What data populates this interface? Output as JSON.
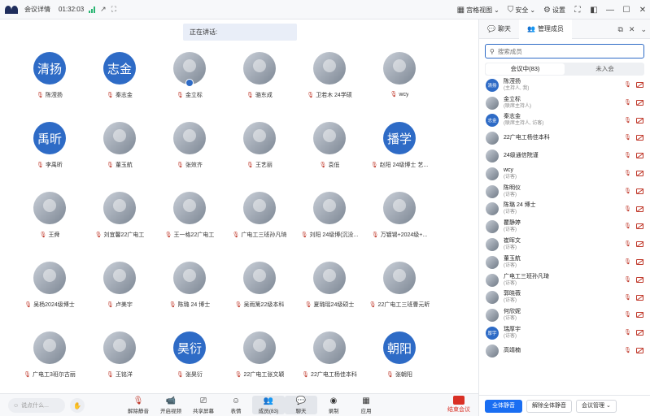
{
  "topbar": {
    "title": "会议详情",
    "time": "01:32:03",
    "right": {
      "gallery": "宫格视图",
      "security": "安全",
      "settings": "设置"
    }
  },
  "main": {
    "speaking_label": "正在讲话:",
    "tiles": [
      {
        "name": "陈滢扬",
        "avatar_text": "清扬",
        "badge": "host"
      },
      {
        "name": "秦志金",
        "avatar_text": "志金",
        "badge": "cohost"
      },
      {
        "name": "金立标",
        "avatar_text": "",
        "badge": "cohost"
      },
      {
        "name": "骆东成",
        "avatar_text": "",
        "badge": ""
      },
      {
        "name": "卫若木 24学硕",
        "avatar_text": "",
        "badge": ""
      },
      {
        "name": "wcy",
        "avatar_text": "",
        "badge": ""
      },
      {
        "name": "李禹昕",
        "avatar_text": "禹昕",
        "badge": ""
      },
      {
        "name": "董玉航",
        "avatar_text": "",
        "badge": ""
      },
      {
        "name": "张效齐",
        "avatar_text": "",
        "badge": ""
      },
      {
        "name": "王艺丽",
        "avatar_text": "",
        "badge": ""
      },
      {
        "name": "袁低",
        "avatar_text": "",
        "badge": ""
      },
      {
        "name": "赵阳 24级博士 艺...",
        "avatar_text": "播学",
        "badge": ""
      },
      {
        "name": "王舜",
        "avatar_text": "",
        "badge": ""
      },
      {
        "name": "刘宜馨22广电工",
        "avatar_text": "",
        "badge": ""
      },
      {
        "name": "王一格22广电工",
        "avatar_text": "",
        "badge": ""
      },
      {
        "name": "广电工三班孙凡琦",
        "avatar_text": "",
        "badge": ""
      },
      {
        "name": "刘阳 24级博(沉没...",
        "avatar_text": "",
        "badge": ""
      },
      {
        "name": "万镀锡+2024级+...",
        "avatar_text": "",
        "badge": ""
      },
      {
        "name": "吴杨2024级博士",
        "avatar_text": "",
        "badge": ""
      },
      {
        "name": "卢美宇",
        "avatar_text": "",
        "badge": ""
      },
      {
        "name": "陈璐 24 博士",
        "avatar_text": "",
        "badge": ""
      },
      {
        "name": "吴雨篱22级本科",
        "avatar_text": "",
        "badge": ""
      },
      {
        "name": "夏璐瑶24级硕士",
        "avatar_text": "",
        "badge": ""
      },
      {
        "name": "22广电工三班曹元昕",
        "avatar_text": "",
        "badge": ""
      },
      {
        "name": "广电工3班尔古丽",
        "avatar_text": "",
        "badge": ""
      },
      {
        "name": "王铭洋",
        "avatar_text": "",
        "badge": ""
      },
      {
        "name": "张昊衍",
        "avatar_text": "昊衍",
        "badge": ""
      },
      {
        "name": "22广电工张文颖",
        "avatar_text": "",
        "badge": ""
      },
      {
        "name": "22广电工杨佳本科",
        "avatar_text": "",
        "badge": ""
      },
      {
        "name": "张朝阳",
        "avatar_text": "朝阳",
        "badge": ""
      }
    ]
  },
  "bottombar": {
    "say_placeholder": "说点什么...",
    "tools": [
      {
        "id": "unmute",
        "label": "解除静音"
      },
      {
        "id": "video",
        "label": "开启视频"
      },
      {
        "id": "share",
        "label": "共享屏幕"
      },
      {
        "id": "react",
        "label": "表情"
      },
      {
        "id": "members",
        "label": "成员(83)"
      },
      {
        "id": "chat",
        "label": "聊天"
      },
      {
        "id": "record",
        "label": "录制"
      },
      {
        "id": "apps",
        "label": "应用"
      }
    ],
    "leave_label": "结束会议"
  },
  "panel": {
    "tab_chat": "聊天",
    "tab_members": "管理成员",
    "search_placeholder": "搜索成员",
    "seg_in": "会议中(83)",
    "seg_out": "未入会",
    "members": [
      {
        "name": "陈滢扬",
        "role": "(主持人, 我)",
        "avatar_text": "清扬"
      },
      {
        "name": "金立标",
        "role": "(联席主持人)",
        "avatar_text": ""
      },
      {
        "name": "秦志金",
        "role": "(联席主持人, 访客)",
        "avatar_text": "志金"
      },
      {
        "name": "22广电工杨佳本科",
        "role": "",
        "avatar_text": ""
      },
      {
        "name": "24级通信院谨",
        "role": "",
        "avatar_text": ""
      },
      {
        "name": "wcy",
        "role": "(访客)",
        "avatar_text": ""
      },
      {
        "name": "陈明仪",
        "role": "(访客)",
        "avatar_text": ""
      },
      {
        "name": "陈璐 24 博士",
        "role": "(访客)",
        "avatar_text": ""
      },
      {
        "name": "瞿静婷",
        "role": "(访客)",
        "avatar_text": ""
      },
      {
        "name": "崔晖文",
        "role": "(访客)",
        "avatar_text": ""
      },
      {
        "name": "董玉航",
        "role": "(访客)",
        "avatar_text": ""
      },
      {
        "name": "广电工三班孙凡琦",
        "role": "(访客)",
        "avatar_text": ""
      },
      {
        "name": "郭晓薇",
        "role": "(访客)",
        "avatar_text": ""
      },
      {
        "name": "何欣妮",
        "role": "(访客)",
        "avatar_text": ""
      },
      {
        "name": "瑞厚宇",
        "role": "(访客)",
        "avatar_text": "厚宇"
      },
      {
        "name": "高靖楠",
        "role": "",
        "avatar_text": ""
      }
    ],
    "footer": {
      "mute_all": "全体静音",
      "unmute_all": "解除全体静音",
      "manage": "会议管理"
    }
  }
}
